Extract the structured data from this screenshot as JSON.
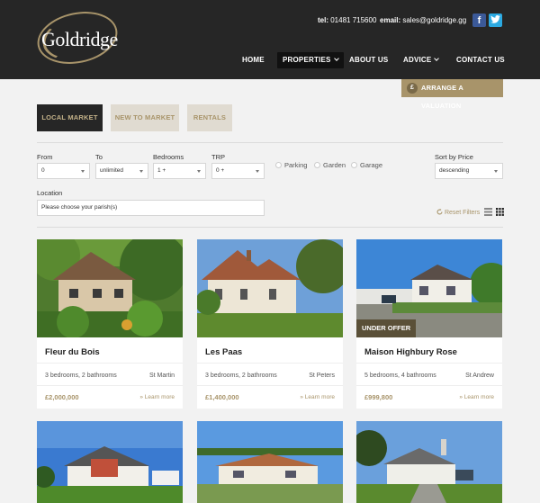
{
  "brand": {
    "logo_text": "Goldridge"
  },
  "contact": {
    "tel_label": "tel:",
    "tel_value": "01481 715600",
    "email_label": "email:",
    "email_value": "sales@goldridge.gg"
  },
  "social": {
    "facebook": "f",
    "twitter": "twitter-icon"
  },
  "nav": {
    "home": "HOME",
    "properties": "PROPERTIES",
    "about": "ABOUT US",
    "advice": "ADVICE",
    "contact": "CONTACT US"
  },
  "valuation": {
    "icon": "£",
    "label": "ARRANGE A VALUATION"
  },
  "tabs": [
    "LOCAL MARKET",
    "NEW TO MARKET",
    "RENTALS"
  ],
  "filters": {
    "from_label": "From",
    "from_value": "0",
    "to_label": "To",
    "to_value": "unlimited",
    "bedrooms_label": "Bedrooms",
    "bedrooms_value": "1 +",
    "trp_label": "TRP",
    "trp_value": "0 +",
    "parking": "Parking",
    "garden": "Garden",
    "garage": "Garage",
    "sort_label": "Sort by Price",
    "sort_value": "descending",
    "location_label": "Location",
    "location_value": "Please choose your parish(s)",
    "reset": "Reset Filters"
  },
  "properties": [
    {
      "title": "Fleur du Bois",
      "beds": "3 bedrooms, 2 bathrooms",
      "parish": "St Martin",
      "price": "£2,000,000",
      "more": "» Learn more"
    },
    {
      "title": "Les Paas",
      "beds": "3 bedrooms, 2 bathrooms",
      "parish": "St Peters",
      "price": "£1,400,000",
      "more": "» Learn more"
    },
    {
      "title": "Maison Highbury Rose",
      "beds": "5 bedrooms, 4 bathrooms",
      "parish": "St Andrew",
      "price": "£999,800",
      "more": "» Learn more",
      "badge": "UNDER OFFER"
    }
  ],
  "colors": {
    "accent": "#a8946a",
    "dark": "#262626",
    "background": "#f2f2f2"
  }
}
